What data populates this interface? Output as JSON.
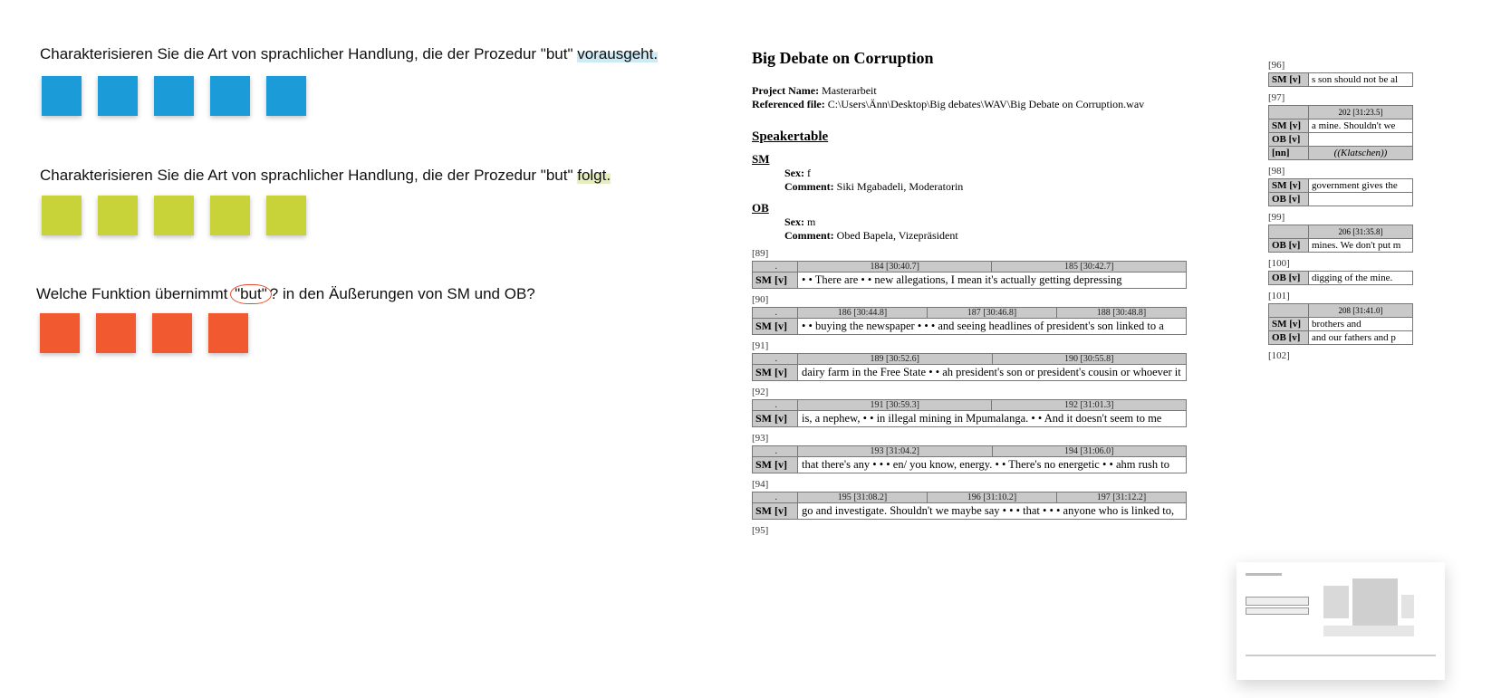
{
  "prompts": {
    "q1_pre": "Charakterisieren Sie die Art von sprachlicher Handlung, die der Prozedur \"but\" ",
    "q1_hl": "vorausgeht.",
    "q2_pre": "Charakterisieren Sie die Art von sprachlicher Handlung, die der Prozedur \"but\" ",
    "q2_hl": "folgt.",
    "q3_pre": "Welche Funktion übernimmt ",
    "q3_circ": "\"but\"",
    "q3_post": "? in den Äußerungen von SM und OB?"
  },
  "doc": {
    "title": "Big Debate on Corruption",
    "project_label": "Project Name:",
    "project_value": "Masterarbeit",
    "reffile_label": "Referenced file:",
    "reffile_value": "C:\\Users\\Änn\\Desktop\\Big debates\\WAV\\Big Debate on Corruption.wav",
    "speakertable": "Speakertable",
    "speakers": {
      "SM": {
        "abbr": "SM",
        "sex_label": "Sex:",
        "sex": "f",
        "comment_label": "Comment:",
        "comment": "Siki Mgabadeli, Moderatorin"
      },
      "OB": {
        "abbr": "OB",
        "sex_label": "Sex:",
        "sex": "m",
        "comment_label": "Comment:",
        "comment": "Obed Bapela, Vizepräsident"
      }
    },
    "segments": [
      {
        "num": "[89]",
        "times": [
          "184 [30:40.7]",
          "185 [30:42.7]"
        ],
        "rows": [
          {
            "label": "SM [v]",
            "text": "• • There are • • new allegations,  I mean it's actually getting depressing"
          }
        ]
      },
      {
        "num": "[90]",
        "times": [
          "186 [30:44.8]",
          "187 [30:46.8]",
          "188 [30:48.8]"
        ],
        "rows": [
          {
            "label": "SM [v]",
            "text": "• • buying the newspaper • • • and  seeing headlines of president's son linked  to a"
          }
        ]
      },
      {
        "num": "[91]",
        "times": [
          "189 [30:52.6]",
          "190 [30:55.8]"
        ],
        "rows": [
          {
            "label": "SM [v]",
            "text": "dairy farm in the Free State • • ah president's son or president's cousin or  whoever it"
          }
        ]
      },
      {
        "num": "[92]",
        "times": [
          "191 [30:59.3]",
          "192 [31:01.3]"
        ],
        "rows": [
          {
            "label": "SM [v]",
            "text": "is, a nephew, • • in illegal mining in Mpumalanga.  • • And it doesn't seem  to me"
          }
        ]
      },
      {
        "num": "[93]",
        "times": [
          "193 [31:04.2]",
          "194 [31:06.0]"
        ],
        "rows": [
          {
            "label": "SM [v]",
            "text": "that there's any • • • en/ you know, energy.  • • There's no energetic • •  ahm rush to"
          }
        ]
      },
      {
        "num": "[94]",
        "times": [
          "195 [31:08.2]",
          "196 [31:10.2]",
          "197 [31:12.2]"
        ],
        "rows": [
          {
            "label": "SM [v]",
            "text": "go and investigate.  Shouldn't we maybe say • • •  that • • • anyone  who is linked to,"
          }
        ]
      },
      {
        "num": "[95]"
      }
    ]
  },
  "doc2": {
    "items": [
      {
        "num": "[96]"
      },
      {
        "rows": [
          {
            "label": "SM [v]",
            "text": "s son should not be al"
          }
        ]
      },
      {
        "num": "[97]"
      },
      {
        "times": [
          "202 [31:23.5]"
        ],
        "rows": [
          {
            "label": "SM [v]",
            "text": "a mine. Shouldn't we"
          },
          {
            "label": "OB [v]",
            "text": ""
          },
          {
            "label": "[nn]",
            "text": "((Klatschen))",
            "italic": true
          }
        ]
      },
      {
        "num": "[98]"
      },
      {
        "rows": [
          {
            "label": "SM [v]",
            "text": "government gives the"
          },
          {
            "label": "OB [v]",
            "text": ""
          }
        ]
      },
      {
        "num": "[99]"
      },
      {
        "times": [
          "206 [31:35.8]"
        ],
        "rows": [
          {
            "label": "OB [v]",
            "text": "mines. We don't put m"
          }
        ]
      },
      {
        "num": "[100]"
      },
      {
        "rows": [
          {
            "label": "OB [v]",
            "text": "digging of the mine.  "
          }
        ]
      },
      {
        "num": "[101]"
      },
      {
        "times": [
          "208 [31:41.0]"
        ],
        "rows": [
          {
            "label": "SM [v]",
            "text": "brothers and"
          },
          {
            "label": "OB [v]",
            "text": "and our fathers and p"
          }
        ]
      },
      {
        "num": "[102]"
      }
    ]
  }
}
